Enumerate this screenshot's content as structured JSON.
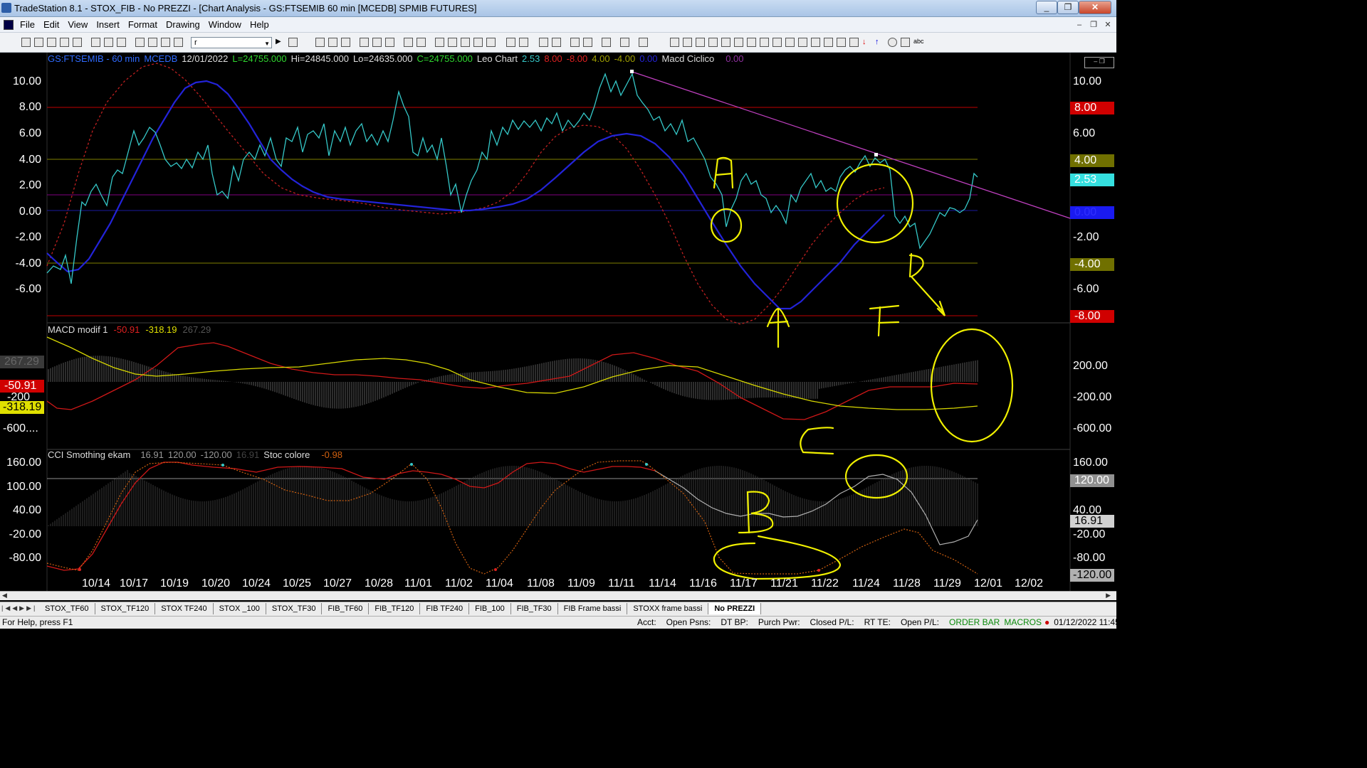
{
  "window": {
    "title": "TradeStation 8.1 - STOX_FIB - No PREZZI - [Chart Analysis - GS:FTSEMIB  60 min  [MCEDB] SPMIB FUTURES]"
  },
  "menu": {
    "items": [
      "File",
      "Edit",
      "View",
      "Insert",
      "Format",
      "Drawing",
      "Window",
      "Help"
    ]
  },
  "toolbar": {
    "symbol_value": "r"
  },
  "chart_header": {
    "symbol": "GS:FTSEMIB - 60 min",
    "study": "MCEDB",
    "date": "12/01/2022",
    "last": "L=24755.000",
    "high": "Hi=24845.000",
    "low": "Lo=24635.000",
    "close": "C=24755.000",
    "indicator": "Leo Chart",
    "v1": "2.53",
    "v2": "8.00",
    "v3": "-8.00",
    "v4": "4.00",
    "v5": "-4.00",
    "v6": "0.00",
    "indicator2": "Macd Ciclico",
    "v7": "0.00"
  },
  "macd_header": {
    "label": "MACD modif 1",
    "v1": "-50.91",
    "v2": "-318.19",
    "v3": "267.29"
  },
  "cci_header": {
    "label": "CCI Smothing ekam",
    "v1": "16.91",
    "v2": "120.00",
    "v3": "-120.00",
    "v4": "16.91",
    "label2": "Stoc colore",
    "v5": "-0.98"
  },
  "axes": {
    "main_left": [
      "10.00",
      "8.00",
      "6.00",
      "4.00",
      "2.00",
      "0.00",
      "-2.00",
      "-4.00",
      "-6.00"
    ],
    "main_right": [
      "10.00",
      "6.00",
      "-2.00",
      "-4.00",
      "-6.00"
    ],
    "main_right_badges": {
      "b8": "8.00",
      "b4": "4.00",
      "b253": "2.53",
      "b0": "0.00",
      "bm4": "-4.00",
      "bm8": "-8.00"
    },
    "macd_left": [
      "-200",
      "-600...."
    ],
    "macd_left_badges": {
      "g": "267.29",
      "r": "-50.91",
      "y": "-318.19"
    },
    "macd_right": [
      "200.00",
      "-200.00",
      "-600.00"
    ],
    "cci_left": [
      "160.00",
      "100.00",
      "40.00",
      "-20.00",
      "-80.00"
    ],
    "cci_right": [
      "160.00",
      "40.00",
      "-20.00",
      "-80.00"
    ],
    "cci_right_badges": {
      "b120": "120.00",
      "b16": "16.91",
      "bm120": "-120.00"
    },
    "dates": [
      "10/14",
      "10/17",
      "10/19",
      "10/20",
      "10/24",
      "10/25",
      "10/27",
      "10/28",
      "11/01",
      "11/02",
      "11/04",
      "11/08",
      "11/09",
      "11/11",
      "11/14",
      "11/16",
      "11/17",
      "11/21",
      "11/22",
      "11/24",
      "11/28",
      "11/29",
      "12/01",
      "12/02"
    ]
  },
  "annotations": {
    "A1": "A",
    "A2": "A",
    "F": "F",
    "B": "B",
    "C": "C"
  },
  "tabs": [
    "STOX_TF60",
    "STOX_TF120",
    "STOX TF240",
    "STOX _100",
    "STOX_TF30",
    "FIB_TF60",
    "FIB_TF120",
    "FIB TF240",
    "FIB_100",
    "FIB_TF30",
    "FIB Frame bassi",
    "STOXX frame bassi",
    "No PREZZI"
  ],
  "status": {
    "help": "For Help, press F1",
    "acct": "Acct:",
    "open_psns": "Open Psns:",
    "dt_bp": "DT BP:",
    "purch_pwr": "Purch Pwr:",
    "closed_pl": "Closed P/L:",
    "rt_te": "RT TE:",
    "open_pl": "Open P/L:",
    "order_bar": "ORDER BAR",
    "macros": "MACROS",
    "datetime": "01/12/2022 11:45"
  },
  "colors": {
    "cyan": "#35c8c8",
    "blue": "#2323d8",
    "red_dotted": "#c02020",
    "magenta": "#c040c0",
    "yellow_marker": "#f0f000",
    "level_red": "#c00000",
    "level_olive": "#808000"
  }
}
